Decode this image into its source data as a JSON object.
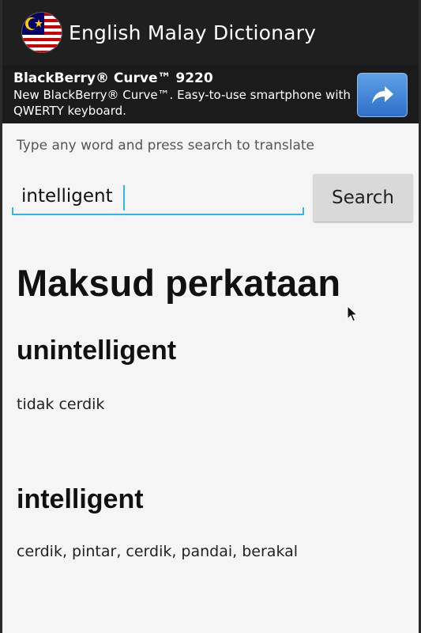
{
  "app": {
    "title": "English Malay Dictionary"
  },
  "ad": {
    "title": "BlackBerry® Curve™ 9220",
    "description": "New BlackBerry® Curve™. Easy-to-use smartphone with QWERTY keyboard.",
    "button_icon": "share-arrow-icon"
  },
  "search": {
    "hint": "Type any word and press search to translate",
    "value": "intelligent",
    "button_label": "Search"
  },
  "results": {
    "heading": "Maksud perkataan",
    "entries": [
      {
        "word": "unintelligent",
        "meaning": "tidak cerdik"
      },
      {
        "word": "intelligent",
        "meaning": "cerdik, pintar, cerdik, pandai, berakal"
      }
    ]
  },
  "colors": {
    "action_bar": "#1f1f1f",
    "ad_background": "#1b1b1b",
    "accent": "#33b5e5",
    "ad_button": "#2f6fc8",
    "background": "#f5f5f5"
  }
}
